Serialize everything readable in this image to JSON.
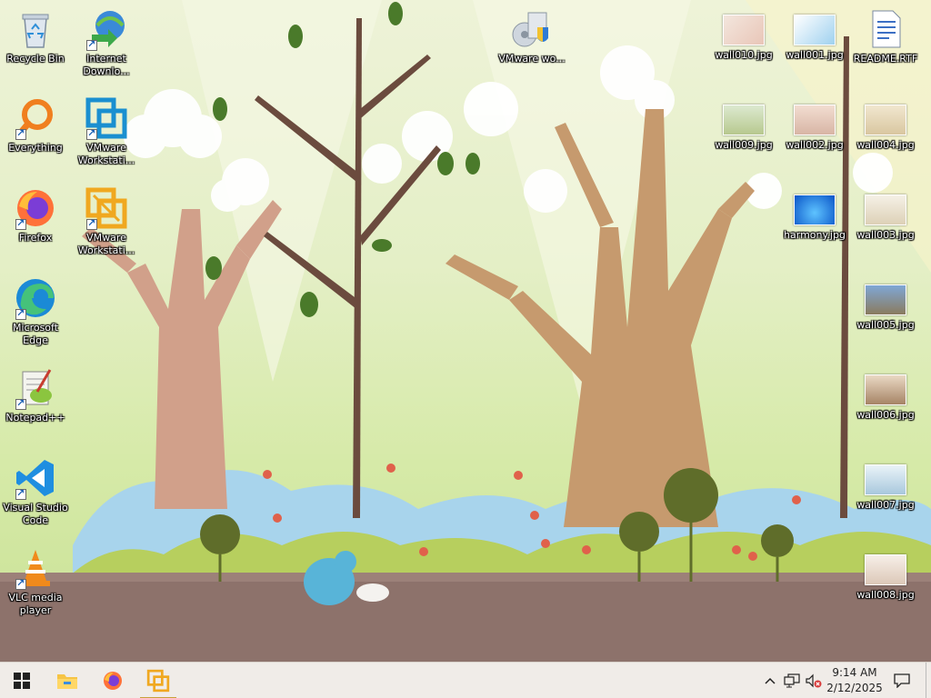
{
  "desktop": {
    "left_icons": [
      {
        "label": "Recycle Bin",
        "icon": "recycle-bin-icon"
      },
      {
        "label": "Internet Downlo...",
        "icon": "internet-download-manager-icon"
      },
      {
        "label": "Everything",
        "icon": "everything-search-icon"
      },
      {
        "label": "VMware Workstati...",
        "icon": "vmware-workstation-icon"
      },
      {
        "label": "Firefox",
        "icon": "firefox-icon"
      },
      {
        "label": "VMware Workstati...",
        "icon": "vmware-workstation-pro-icon"
      },
      {
        "label": "Microsoft Edge",
        "icon": "edge-icon"
      },
      {
        "label": "Notepad++",
        "icon": "notepad-plus-plus-icon"
      },
      {
        "label": "Visual Studio Code",
        "icon": "vscode-icon"
      },
      {
        "label": "VLC media player",
        "icon": "vlc-icon"
      }
    ],
    "vmware_wo": {
      "label": "VMware wo...",
      "icon": "vmware-installer-icon"
    },
    "right_icons": [
      {
        "label": "wall010.jpg",
        "icon": "image-thumbnail-icon"
      },
      {
        "label": "wall001.jpg",
        "icon": "image-thumbnail-icon"
      },
      {
        "label": "README.RTF",
        "icon": "rtf-document-icon"
      },
      {
        "label": "wall009.jpg",
        "icon": "image-thumbnail-icon"
      },
      {
        "label": "wall002.jpg",
        "icon": "image-thumbnail-icon"
      },
      {
        "label": "wall004.jpg",
        "icon": "image-thumbnail-icon"
      },
      {
        "label": "harmony.jpg",
        "icon": "image-thumbnail-icon"
      },
      {
        "label": "wall003.jpg",
        "icon": "image-thumbnail-icon"
      },
      {
        "label": "wall005.jpg",
        "icon": "image-thumbnail-icon"
      },
      {
        "label": "wall006.jpg",
        "icon": "image-thumbnail-icon"
      },
      {
        "label": "wall007.jpg",
        "icon": "image-thumbnail-icon"
      },
      {
        "label": "wall008.jpg",
        "icon": "image-thumbnail-icon"
      }
    ]
  },
  "taskbar": {
    "start": "windows-start-icon",
    "pinned": [
      "file-explorer-icon",
      "firefox-icon",
      "vmware-workstation-icon"
    ],
    "clock_time": "9:14 AM",
    "clock_date": "2/12/2025"
  },
  "colors": {
    "taskbar_bg": "#f0ece8",
    "accent_active": "#c9a13a"
  }
}
